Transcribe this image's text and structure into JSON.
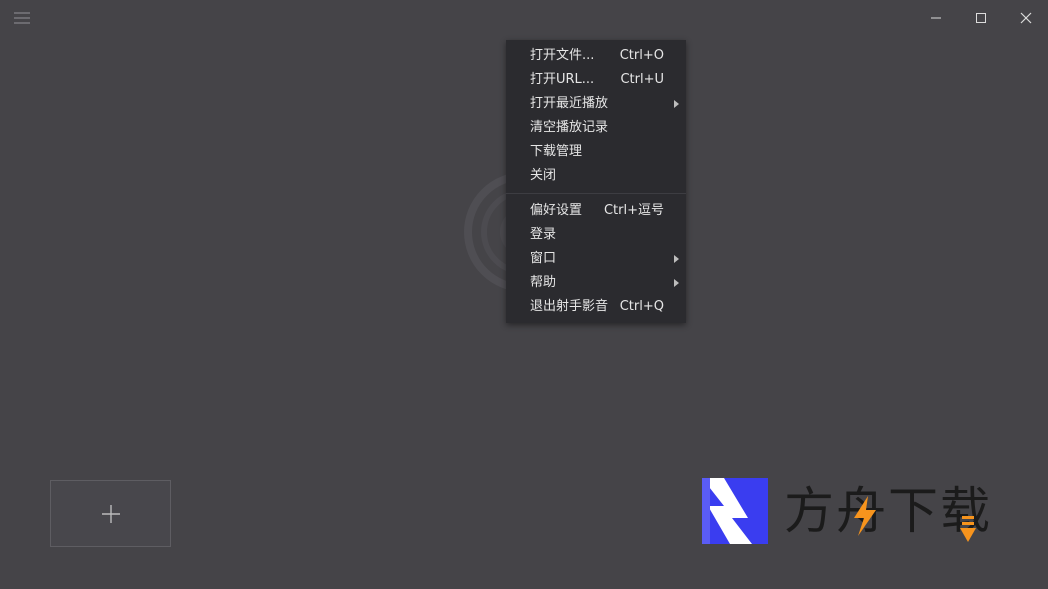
{
  "window_controls": {
    "minimize": "minimize-icon",
    "maximize": "maximize-icon",
    "close": "close-icon"
  },
  "context_menu": {
    "group1": [
      {
        "label": "打开文件...",
        "shortcut": "Ctrl+O",
        "submenu": false
      },
      {
        "label": "打开URL...",
        "shortcut": "Ctrl+U",
        "submenu": false
      },
      {
        "label": "打开最近播放",
        "shortcut": "",
        "submenu": true
      },
      {
        "label": "清空播放记录",
        "shortcut": "",
        "submenu": false
      },
      {
        "label": "下载管理",
        "shortcut": "",
        "submenu": false
      },
      {
        "label": "关闭",
        "shortcut": "",
        "submenu": false
      }
    ],
    "group2": [
      {
        "label": "偏好设置",
        "shortcut": "Ctrl+逗号",
        "submenu": false
      },
      {
        "label": "登录",
        "shortcut": "",
        "submenu": false
      },
      {
        "label": "窗口",
        "shortcut": "",
        "submenu": true
      },
      {
        "label": "帮助",
        "shortcut": "",
        "submenu": true
      },
      {
        "label": "退出射手影音",
        "shortcut": "Ctrl+Q",
        "submenu": false
      }
    ]
  },
  "add_button": {
    "icon": "plus-icon"
  },
  "brand": {
    "text": "方舟下载"
  },
  "colors": {
    "background": "#454448",
    "menu_bg": "#2b2b2f",
    "menu_text": "#e6e6e6",
    "brand_blue": "#3a3df0",
    "brand_orange": "#f7941d"
  }
}
